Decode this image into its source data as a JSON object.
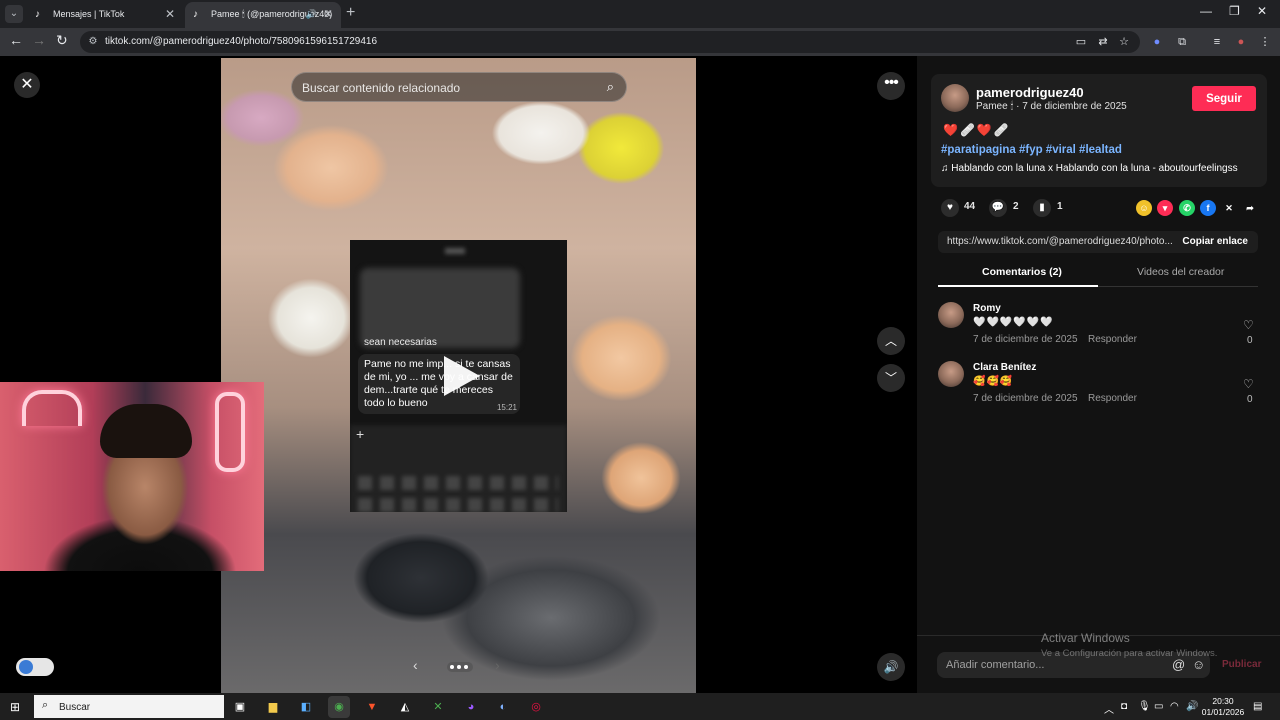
{
  "browser": {
    "tabs": [
      {
        "title": "Mensajes | TikTok",
        "active": false
      },
      {
        "title": "Pamee 🕯 (@pamerodriguez40)",
        "active": true
      }
    ],
    "url": "tiktok.com/@pamerodriguez40/photo/7580961596151729416",
    "icons": [
      "tab-search-icon",
      "new-tab-icon",
      "minimize-icon",
      "restore-icon",
      "close-window-icon",
      "back-icon",
      "forward-icon",
      "reload-icon",
      "site-info-icon",
      "cast-icon",
      "translate-icon",
      "star-icon",
      "extensions-icon",
      "profile-icon",
      "menu-icon"
    ]
  },
  "viewer": {
    "search_placeholder": "Buscar contenido relacionado",
    "chat": {
      "partial_text": "sean necesarias",
      "message": "Pame no me imp... si te cansas de mi, yo ... me voy a cansar de dem...trarte qué te mereces todo lo bueno",
      "time": "15:21"
    }
  },
  "post": {
    "username": "pamerodriguez40",
    "display_name": "Pamee 🕯",
    "date": "7 de diciembre de 2025",
    "follow_label": "Seguir",
    "emojis": "❤️🩹❤️🩹",
    "hashtags": "#paratipagina #fyp #viral #lealtad",
    "music": "Hablando con la luna x Hablando con la luna - aboutourfeelingss",
    "likes": "44",
    "comments": "2",
    "saves": "1",
    "link": "https://www.tiktok.com/@pamerodriguez40/photo...",
    "copy_label": "Copiar enlace",
    "tabs": [
      {
        "label": "Comentarios (2)",
        "active": true
      },
      {
        "label": "Videos del creador",
        "active": false
      }
    ]
  },
  "comments": [
    {
      "name": "Romy",
      "text": "🤍🤍🤍🤍🤍🤍",
      "date": "7 de diciembre de 2025",
      "reply": "Responder",
      "likes": "0"
    },
    {
      "name": "Clara Benítez",
      "text": "🥰🥰🥰",
      "date": "7 de diciembre de 2025",
      "reply": "Responder",
      "likes": "0"
    }
  ],
  "comment_bar": {
    "placeholder": "Añadir comentario...",
    "publish_label": "Publicar"
  },
  "watermark": {
    "line1": "Activar Windows",
    "line2": "Ve a Configuración para activar Windows."
  },
  "taskbar": {
    "search_label": "Buscar",
    "time": "20:30",
    "date": "01/01/2026"
  },
  "colors": {
    "follow": "#fe2c55",
    "hashtag": "#7bb5ff",
    "panel_bg": "#121212"
  }
}
